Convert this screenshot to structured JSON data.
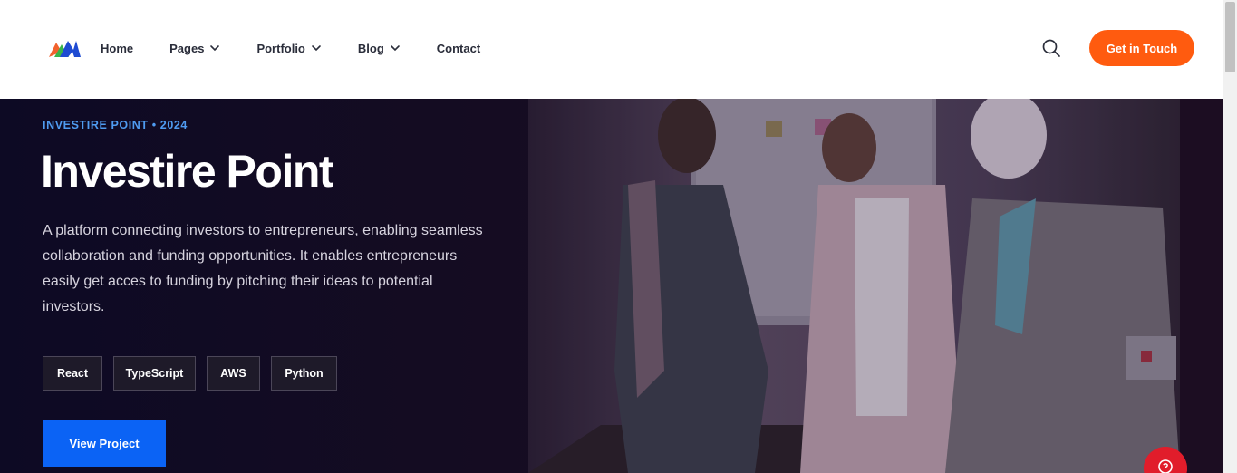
{
  "header": {
    "logo_icon": "brand-logo-icon",
    "nav": [
      {
        "label": "Home",
        "has_dropdown": false
      },
      {
        "label": "Pages",
        "has_dropdown": true
      },
      {
        "label": "Portfolio",
        "has_dropdown": true
      },
      {
        "label": "Blog",
        "has_dropdown": true
      },
      {
        "label": "Contact",
        "has_dropdown": false
      }
    ],
    "search_icon": "search-icon",
    "cta_label": "Get in Touch",
    "cta_color": "#ff5b0f"
  },
  "hero": {
    "eyebrow": "INVESTIRE POINT • 2024",
    "title": "Investire Point",
    "description": "A platform connecting investors to entrepreneurs, enabling seamless collaboration and funding opportunities. It enables entrepreneurs easily get acces to funding by pitching their ideas to potential investors.",
    "tags": [
      "React",
      "TypeScript",
      "AWS",
      "Python"
    ],
    "button_label": "View Project",
    "accent_color": "#4f9bf0",
    "button_color": "#0b63f5",
    "image_icon": "team-meeting-photo"
  },
  "help_icon": "help-icon"
}
